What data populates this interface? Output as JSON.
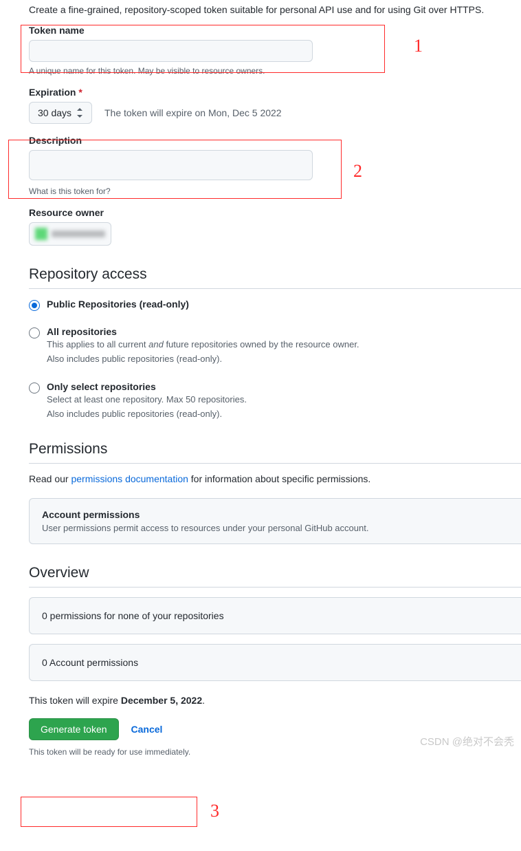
{
  "intro": "Create a fine-grained, repository-scoped token suitable for personal API use and for using Git over HTTPS.",
  "token_name": {
    "label": "Token name",
    "value": "",
    "help": "A unique name for this token. May be visible to resource owners."
  },
  "expiration": {
    "label": "Expiration",
    "required_mark": "*",
    "selected": "30 days",
    "note": "The token will expire on Mon, Dec 5 2022"
  },
  "description": {
    "label": "Description",
    "value": "",
    "help": "What is this token for?"
  },
  "resource_owner": {
    "label": "Resource owner"
  },
  "repo_access": {
    "title": "Repository access",
    "options": [
      {
        "label": "Public Repositories (read-only)",
        "desc1": "",
        "desc2": "",
        "checked": true
      },
      {
        "label": "All repositories",
        "desc1": "This applies to all current and future repositories owned by the resource owner.",
        "desc2": "Also includes public repositories (read-only).",
        "checked": false,
        "em_word": "and"
      },
      {
        "label": "Only select repositories",
        "desc1": "Select at least one repository. Max 50 repositories.",
        "desc2": "Also includes public repositories (read-only).",
        "checked": false
      }
    ]
  },
  "permissions": {
    "title": "Permissions",
    "text_before": "Read our ",
    "link": "permissions documentation",
    "text_after": " for information about specific permissions.",
    "card_title": "Account permissions",
    "card_desc": "User permissions permit access to resources under your personal GitHub account."
  },
  "overview": {
    "title": "Overview",
    "line1": "0 permissions for none of your repositories",
    "line2": "0 Account permissions"
  },
  "expire_summary": {
    "prefix": "This token will expire ",
    "date": "December 5, 2022",
    "suffix": "."
  },
  "actions": {
    "generate": "Generate token",
    "cancel": "Cancel"
  },
  "foot_note": "This token will be ready for use immediately.",
  "annotations": {
    "n1": "1",
    "n2": "2",
    "n3": "3"
  },
  "watermark": "CSDN @绝对不会秃"
}
